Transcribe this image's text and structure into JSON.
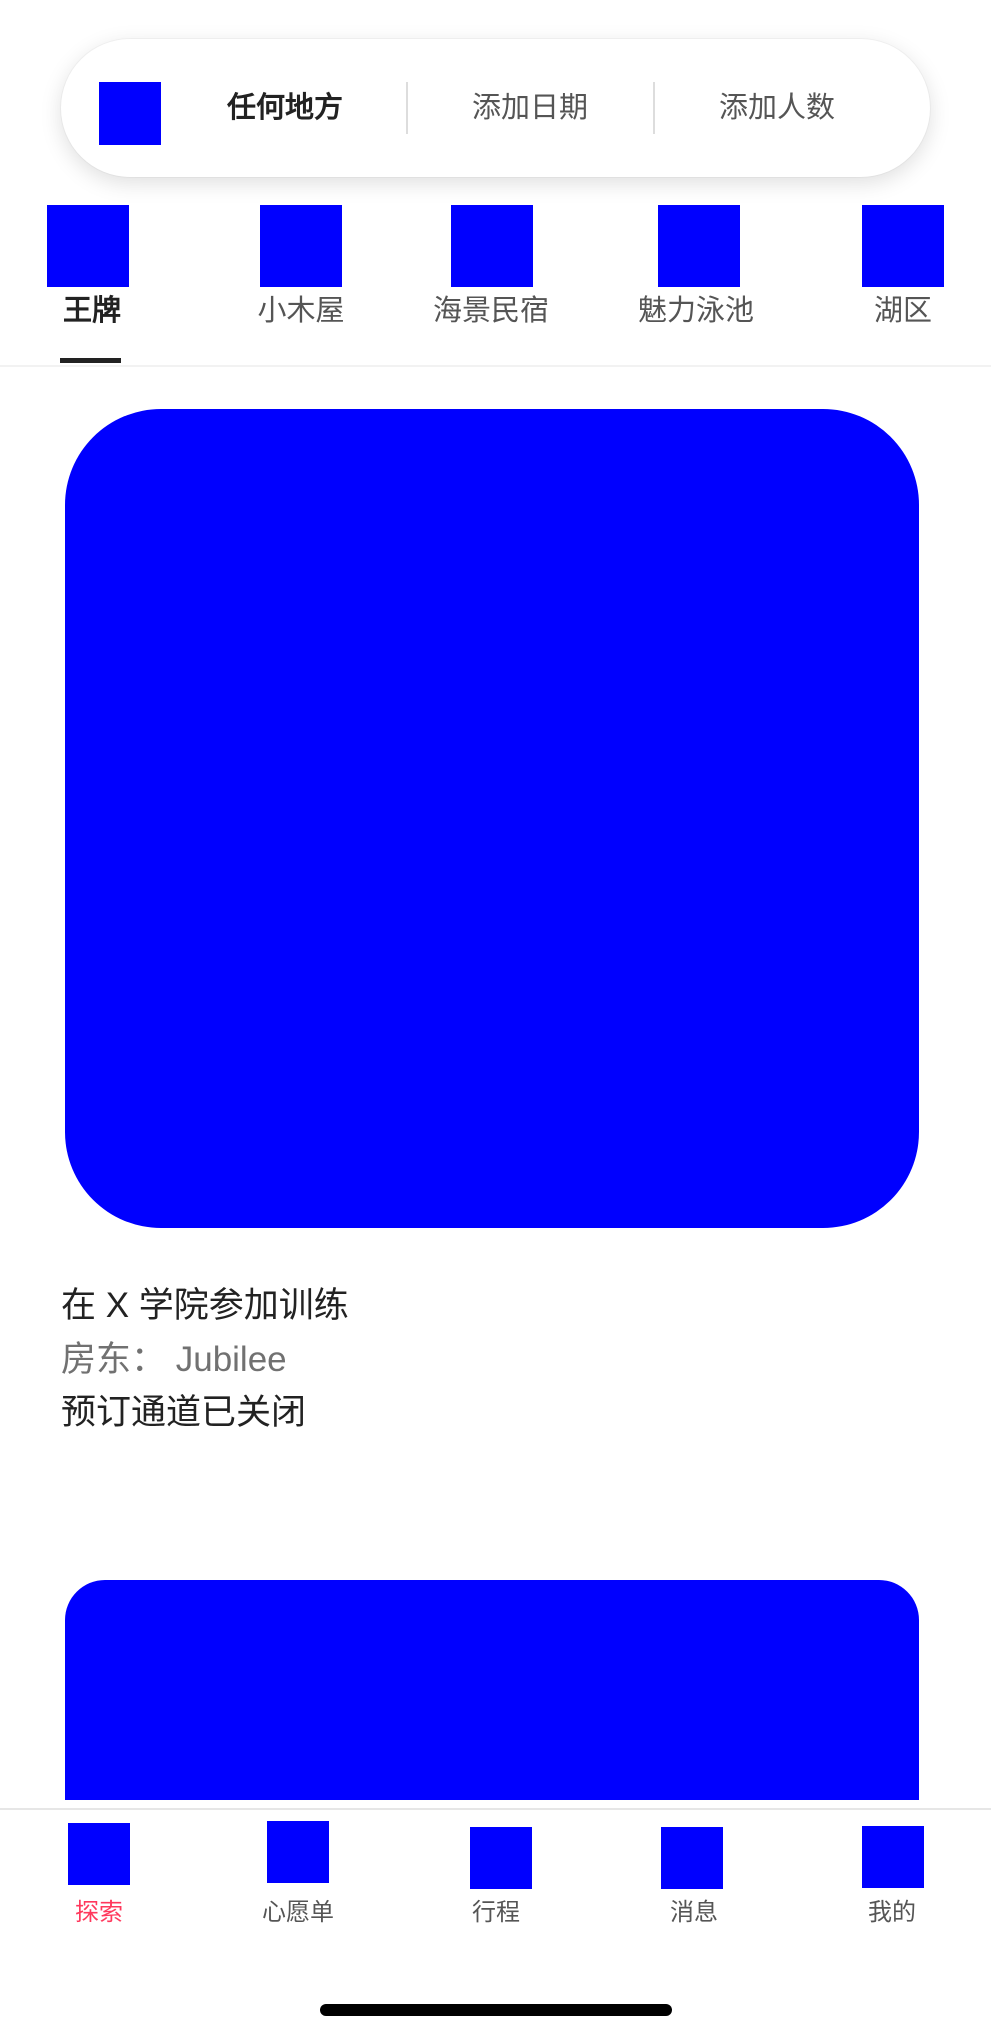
{
  "search": {
    "where": "任何地方",
    "dates": "添加日期",
    "guests": "添加人数"
  },
  "categories": [
    {
      "label": "王牌",
      "active": true
    },
    {
      "label": "小木屋",
      "active": false
    },
    {
      "label": "海景民宿",
      "active": false
    },
    {
      "label": "魅力泳池",
      "active": false
    },
    {
      "label": "湖区",
      "active": false
    }
  ],
  "listing": {
    "title": "在 X 学院参加训练",
    "host": "房东： Jubilee",
    "status": "预订通道已关闭"
  },
  "bottom_nav": [
    {
      "label": "探索",
      "active": true
    },
    {
      "label": "心愿单",
      "active": false
    },
    {
      "label": "行程",
      "active": false
    },
    {
      "label": "消息",
      "active": false
    },
    {
      "label": "我的",
      "active": false
    }
  ],
  "colors": {
    "accent": "#ff385c",
    "placeholder": "#0000ff",
    "text": "#222222",
    "muted": "#717171"
  }
}
